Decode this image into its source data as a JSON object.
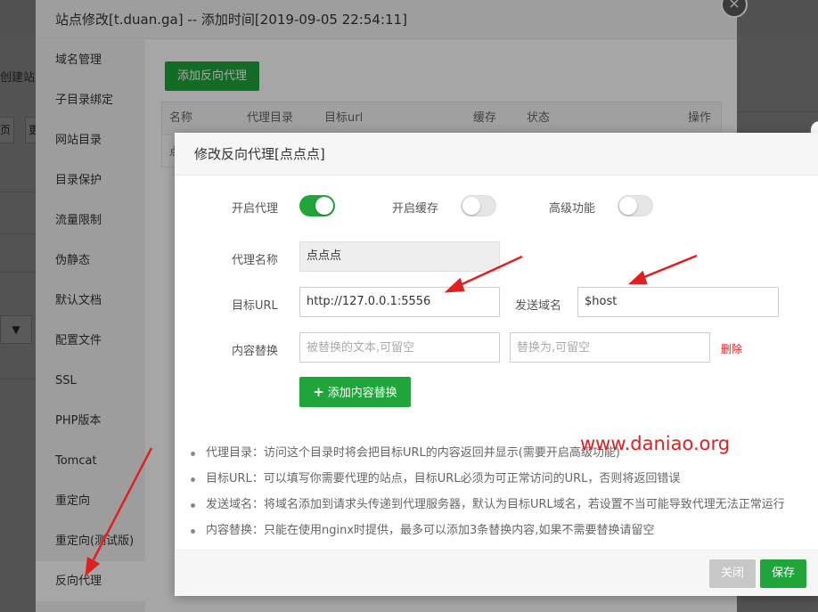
{
  "background": {
    "left_text": "创建站点",
    "left_btn_1": "页",
    "left_btn_2": "更",
    "left_select": "▼"
  },
  "outer_dialog": {
    "title": "站点修改[t.duan.ga] -- 添加时间[2019-09-05 22:54:11]",
    "close_symbol": "×",
    "nav": [
      {
        "label": "域名管理"
      },
      {
        "label": "子目录绑定"
      },
      {
        "label": "网站目录"
      },
      {
        "label": "目录保护"
      },
      {
        "label": "流量限制"
      },
      {
        "label": "伪静态"
      },
      {
        "label": "默认文档"
      },
      {
        "label": "配置文件"
      },
      {
        "label": "SSL"
      },
      {
        "label": "PHP版本"
      },
      {
        "label": "Tomcat"
      },
      {
        "label": "重定向"
      },
      {
        "label": "重定向(测试版)"
      },
      {
        "label": "反向代理"
      }
    ],
    "add_proxy_label": "添加反向代理",
    "table": {
      "columns": [
        "名称",
        "代理目录",
        "目标url",
        "缓存",
        "状态",
        "操作"
      ],
      "row_first_char": "点"
    }
  },
  "inner_dialog": {
    "title": "修改反向代理[点点点]",
    "toggles": {
      "proxy_label": "开启代理",
      "proxy_on": true,
      "cache_label": "开启缓存",
      "cache_on": false,
      "advanced_label": "高级功能",
      "advanced_on": false
    },
    "proxy_name_label": "代理名称",
    "proxy_name_value": "点点点",
    "target_url_label": "目标URL",
    "target_url_value": "http://127.0.0.1:5556",
    "send_domain_label": "发送域名",
    "send_domain_value": "$host",
    "replace_label": "内容替换",
    "replace_from_placeholder": "被替换的文本,可留空",
    "replace_to_placeholder": "替换为,可留空",
    "delete_label": "删除",
    "add_replace_label": "添加内容替换",
    "tips": [
      "代理目录：访问这个目录时将会把目标URL的内容返回并显示(需要开启高级功能)",
      "目标URL：可以填写你需要代理的站点，目标URL必须为可正常访问的URL，否则将返回错误",
      "发送域名：将域名添加到请求头传递到代理服务器，默认为目标URL域名，若设置不当可能导致代理无法正常运行",
      "内容替换：只能在使用nginx时提供，最多可以添加3条替换内容,如果不需要替换请留空"
    ],
    "close_label": "关闭",
    "save_label": "保存"
  },
  "watermark": "www.daniao.org",
  "colors": {
    "accent_green": "#20a53a",
    "danger_red": "#e02020"
  }
}
